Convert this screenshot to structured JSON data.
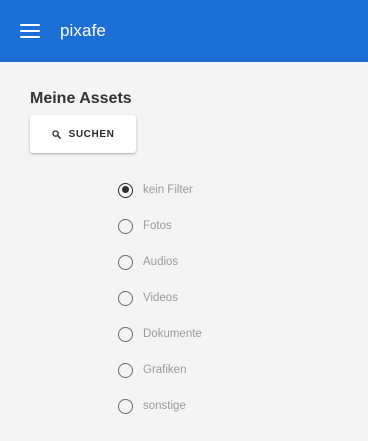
{
  "app_bar": {
    "title": "pixafe",
    "menu_icon": "menu-icon",
    "color": "#1d6fd6"
  },
  "main": {
    "title": "Meine Assets",
    "search_button": {
      "label": "SUCHEN",
      "icon": "search-icon"
    },
    "filters": [
      {
        "label": "kein Filter",
        "checked": true
      },
      {
        "label": "Fotos",
        "checked": false
      },
      {
        "label": "Audios",
        "checked": false
      },
      {
        "label": "Videos",
        "checked": false
      },
      {
        "label": "Dokumente",
        "checked": false
      },
      {
        "label": "Grafiken",
        "checked": false
      },
      {
        "label": "sonstige",
        "checked": false
      }
    ]
  }
}
